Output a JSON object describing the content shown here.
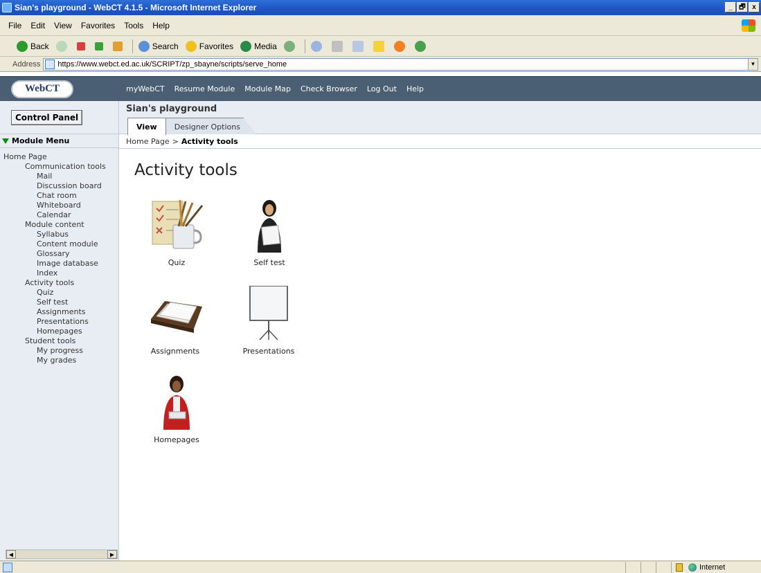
{
  "window": {
    "title": "Sian's playground - WebCT 4.1.5 - Microsoft Internet Explorer",
    "controls": {
      "minimize": "_",
      "maximize": "🗗",
      "close": "x"
    }
  },
  "menubar": [
    "File",
    "Edit",
    "View",
    "Favorites",
    "Tools",
    "Help"
  ],
  "toolbar": {
    "back": "Back",
    "search": "Search",
    "favorites": "Favorites",
    "media": "Media"
  },
  "address": {
    "label": "Address",
    "url": "https://www.webct.ed.ac.uk/SCRIPT/zp_sbayne/scripts/serve_home"
  },
  "webct": {
    "logo": "WebCT",
    "nav": [
      "myWebCT",
      "Resume Module",
      "Module Map",
      "Check Browser",
      "Log Out",
      "Help"
    ]
  },
  "left_panel": {
    "control_panel": "Control Panel",
    "module_menu": "Module Menu",
    "tree": [
      {
        "level": 0,
        "label": "Home Page"
      },
      {
        "level": 1,
        "label": "Communication tools"
      },
      {
        "level": 2,
        "label": "Mail"
      },
      {
        "level": 2,
        "label": "Discussion board"
      },
      {
        "level": 2,
        "label": "Chat room"
      },
      {
        "level": 2,
        "label": "Whiteboard"
      },
      {
        "level": 2,
        "label": "Calendar"
      },
      {
        "level": 1,
        "label": "Module content"
      },
      {
        "level": 2,
        "label": "Syllabus"
      },
      {
        "level": 2,
        "label": "Content module"
      },
      {
        "level": 2,
        "label": "Glossary"
      },
      {
        "level": 2,
        "label": "Image database"
      },
      {
        "level": 2,
        "label": "Index"
      },
      {
        "level": 1,
        "label": "Activity tools"
      },
      {
        "level": 2,
        "label": "Quiz"
      },
      {
        "level": 2,
        "label": "Self test"
      },
      {
        "level": 2,
        "label": "Assignments"
      },
      {
        "level": 2,
        "label": "Presentations"
      },
      {
        "level": 2,
        "label": "Homepages"
      },
      {
        "level": 1,
        "label": "Student tools"
      },
      {
        "level": 2,
        "label": "My progress"
      },
      {
        "level": 2,
        "label": "My grades"
      }
    ]
  },
  "module": {
    "title": "Sian's playground",
    "tabs": {
      "view": "View",
      "designer": "Designer Options"
    }
  },
  "breadcrumb": {
    "home": "Home Page",
    "separator": ">",
    "current": "Activity tools"
  },
  "page": {
    "title": "Activity tools",
    "tools": [
      {
        "label": "Quiz",
        "icon": "quiz-icon"
      },
      {
        "label": "Self test",
        "icon": "self-test-icon"
      },
      {
        "label": "Assignments",
        "icon": "assignments-icon"
      },
      {
        "label": "Presentations",
        "icon": "presentations-icon"
      },
      {
        "label": "Homepages",
        "icon": "homepages-icon"
      }
    ]
  },
  "statusbar": {
    "zone": "Internet"
  }
}
